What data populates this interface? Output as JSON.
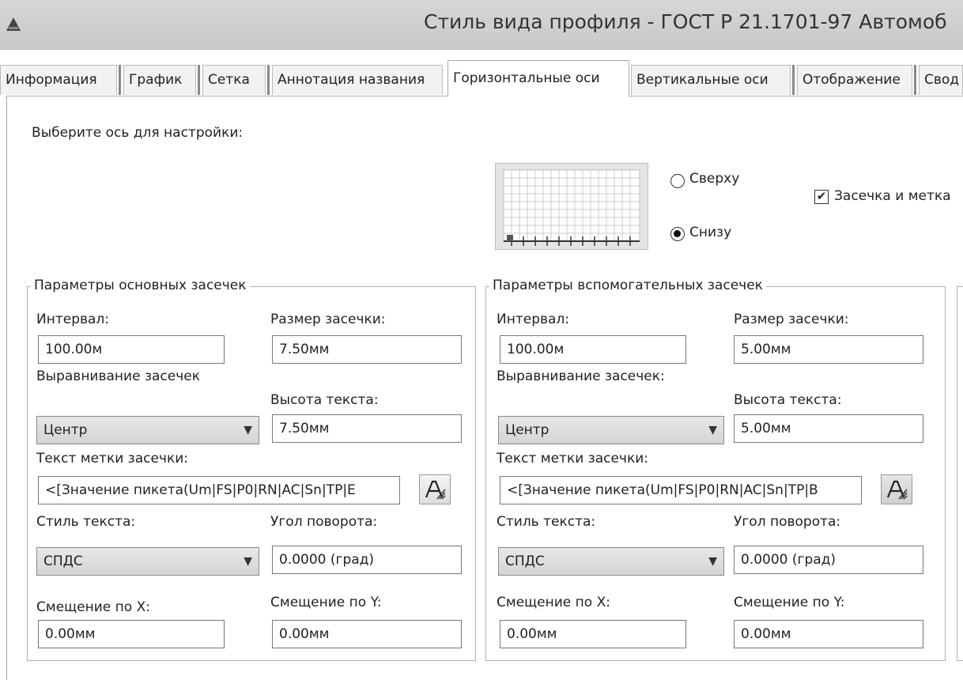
{
  "window": {
    "title": "Стиль вида профиля - ГОСТ Р 21.1701-97 Автомоб"
  },
  "tabs": [
    {
      "label": "Информация",
      "active": false
    },
    {
      "label": "График",
      "active": false
    },
    {
      "label": "Сетка",
      "active": false
    },
    {
      "label": "Аннотация названия",
      "active": false
    },
    {
      "label": "Горизонтальные оси",
      "active": true
    },
    {
      "label": "Вертикальные оси",
      "active": false
    },
    {
      "label": "Отображение",
      "active": false
    },
    {
      "label": "Свод",
      "active": false
    }
  ],
  "axis_select": {
    "label": "Выберите ось для настройки:",
    "top_label": "Сверху",
    "bottom_label": "Снизу",
    "selected": "Снизу",
    "tick_and_label": "Засечка и метка",
    "tick_and_label_checked": true
  },
  "major": {
    "title": "Параметры основных засечек",
    "interval_label": "Интервал:",
    "interval": "100.00м",
    "tick_size_label": "Размер засечки:",
    "tick_size": "7.50мм",
    "justify_label": "Выравнивание засечек",
    "justify": "Центр",
    "text_height_label": "Высота текста:",
    "text_height": "7.50мм",
    "label_text_label": "Текст метки засечки:",
    "label_text": "<[Значение пикета(Um|FS|P0|RN|AC|Sn|TP|E",
    "text_style_label": "Стиль текста:",
    "text_style": "СПДС",
    "rotation_label": "Угол поворота:",
    "rotation": "0.0000 (град)",
    "x_offset_label": "Смещение по X:",
    "x_offset": "0.00мм",
    "y_offset_label": "Смещение по Y:",
    "y_offset": "0.00мм"
  },
  "minor": {
    "title": "Параметры вспомогательных засечек",
    "interval_label": "Интервал:",
    "interval": "100.00м",
    "tick_size_label": "Размер засечки:",
    "tick_size": "5.00мм",
    "justify_label": "Выравнивание засечек:",
    "justify": "Центр",
    "text_height_label": "Высота текста:",
    "text_height": "5.00мм",
    "label_text_label": "Текст метки засечки:",
    "label_text": "<[Значение пикета(Um|FS|P0|RN|AC|Sn|TP|B",
    "text_style_label": "Стиль текста:",
    "text_style": "СПДС",
    "rotation_label": "Угол поворота:",
    "rotation": "0.0000 (град)",
    "x_offset_label": "Смещение по X:",
    "x_offset": "0.00мм",
    "y_offset_label": "Смещение по Y:",
    "y_offset": "0.00мм"
  }
}
